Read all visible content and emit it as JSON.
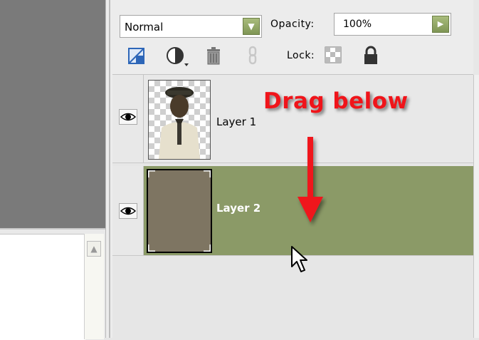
{
  "blend_mode": {
    "value": "Normal"
  },
  "opacity": {
    "label": "Opacity:",
    "value": "100%"
  },
  "lock": {
    "label": "Lock:"
  },
  "tools": [
    "new-layer-icon",
    "adjustment-layer-icon",
    "trash-icon",
    "link-icon",
    "lock-transparent-icon",
    "lock-all-icon"
  ],
  "layers": [
    {
      "name": "Layer 1",
      "visible": true,
      "selected": false
    },
    {
      "name": "Layer 2",
      "visible": true,
      "selected": true
    }
  ],
  "annotation": {
    "text": "Drag below"
  },
  "colors": {
    "selected_row": "#8b9a67",
    "annotation": "#f0141a",
    "layer2_fill": "#7e7562"
  }
}
